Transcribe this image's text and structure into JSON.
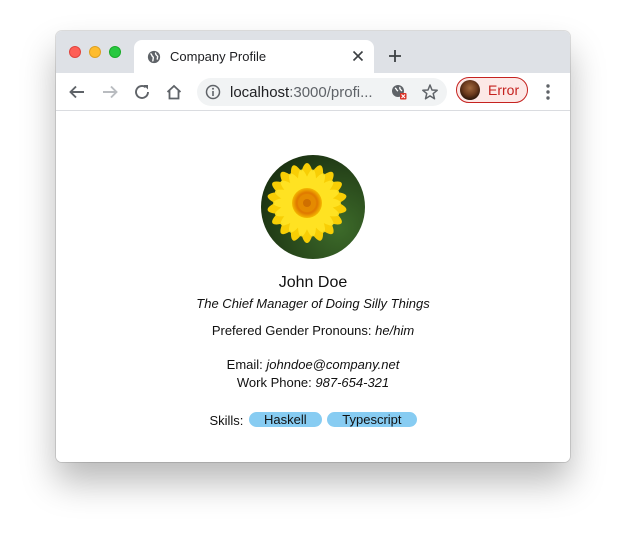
{
  "browser": {
    "tab": {
      "title": "Company Profile",
      "favicon": "globe-icon"
    },
    "url": {
      "host": "localhost",
      "rest": ":3000/profi..."
    },
    "profile": {
      "label": "Error"
    },
    "colors": {
      "error": "#c5221f",
      "tabstrip": "#dee1e6"
    }
  },
  "profile": {
    "name": "John Doe",
    "title": "The Chief Manager of Doing Silly Things",
    "pronouns_label": "Prefered Gender Pronouns:",
    "pronouns_value": "he/him",
    "email_label": "Email:",
    "email_value": "johndoe@company.net",
    "phone_label": "Work Phone:",
    "phone_value": "987-654-321",
    "skills_label": "Skills:",
    "skills": [
      "Haskell",
      "Typescript"
    ],
    "skill_color": "#87ccf2"
  }
}
